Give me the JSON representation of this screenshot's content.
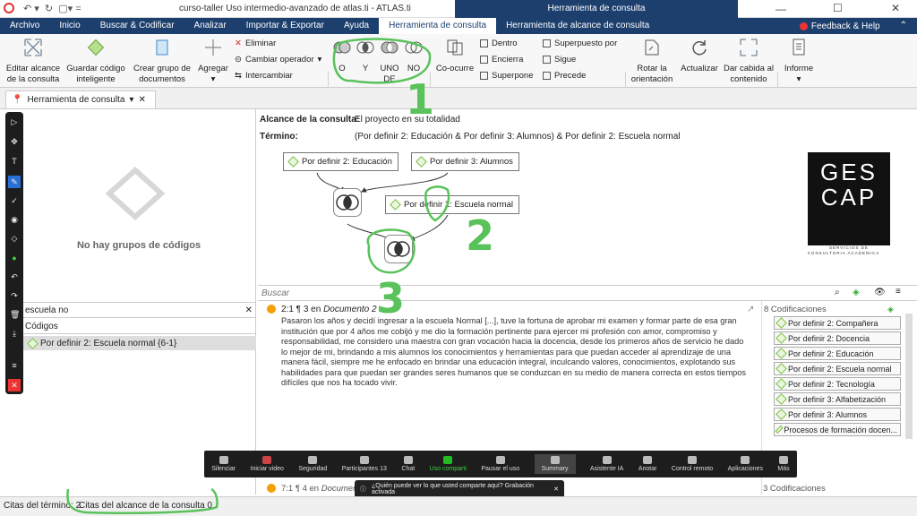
{
  "window": {
    "title": "curso-taller Uso intermedio-avanzado de atlas.ti - ATLAS.ti",
    "context_tab": "Herramienta de consulta"
  },
  "tabs": [
    "Archivo",
    "Inicio",
    "Buscar & Codificar",
    "Analizar",
    "Importar & Exportar",
    "Ayuda",
    "Herramienta de consulta",
    "Herramienta de alcance de consulta"
  ],
  "help": "Feedback & Help",
  "ribbon": {
    "edit_scope": "Editar alcance de la consulta",
    "save_smart": "Guardar código inteligente",
    "create_group": "Crear grupo de documentos",
    "add": "Agregar",
    "delete": "Eliminar",
    "change_op": "Cambiar operador",
    "swap": "Intercambiar",
    "ops": [
      "O",
      "Y",
      "UNO DE",
      "NO"
    ],
    "cooccur": "Co-ocurre",
    "prox": [
      "Dentro",
      "Encierra",
      "Superpone"
    ],
    "prox2": [
      "Superpuesto por",
      "Sigue",
      "Precede"
    ],
    "rotate": "Rotar la orientación",
    "update": "Actualizar",
    "fit": "Dar cabida al contenido",
    "report": "Informe"
  },
  "doc_tab": "Herramienta de consulta",
  "left": {
    "no_groups": "No hay grupos de códigos",
    "search_value": "escuela no",
    "codes_header": "Códigos",
    "code_item": "Por definir 2: Escuela normal {6-1}"
  },
  "query": {
    "scope_label": "Alcance de la consulta:",
    "scope_value": "El proyecto en su totalidad",
    "term_label": "Término:",
    "term_value": "(Por definir 2: Educación & Por definir 3: Alumnos) & Por definir 2: Escuela normal"
  },
  "nodes": [
    "Por definir 2: Educación",
    "Por definir 3: Alumnos",
    "Por definir 2: Escuela normal"
  ],
  "logo": {
    "text1": "GES",
    "text2": "CAP",
    "sub1": "SERVICIOS DE",
    "sub2": "CONSULTORIA ACADEMICA"
  },
  "search_placeholder": "Buscar",
  "quote": {
    "ref": "2:1 ¶ 3 en",
    "doc": "Documento 2",
    "text": "Pasaron los años y decidí ingresar a la escuela Normal [...], tuve la fortuna de aprobar mi examen y formar parte de esa gran institución que por 4 años me cobijó y me dio la formación pertinente para ejercer mi profesión con amor, compromiso y responsabilidad, me considero  una maestra con gran vocación hacia la docencia, desde los primeros años de servicio he dado lo mejor de mi, brindando a mis alumnos los conocimientos y herramientas para que puedan acceder al aprendizaje de una manera fácil, siempre me he enfocado en brindar una educación integral, inculcando valores, conocimientos, explotando sus habilidades para que puedan ser grandes seres humanos que se conduzcan en su medio de manera correcta en estos tiempos difíciles que nos ha tocado vivir.",
    "ref2": "7:1 ¶ 4 en",
    "doc2": "Documento"
  },
  "codings": {
    "header": "8 Codificaciones",
    "items": [
      "Por definir 2: Compañera",
      "Por definir 2: Docencia",
      "Por definir 2: Educación",
      "Por definir 2: Escuela normal",
      "Por definir 2: Tecnología",
      "Por definir 3: Alfabetización",
      "Por definir 3: Alumnos",
      "Procesos de formación docen..."
    ],
    "header2": "3 Codificaciones"
  },
  "zoom": [
    "Silenciar",
    "Iniciar video",
    "Seguridad",
    "Participantes",
    "Chat",
    "Uso comparti",
    "Pausar el uso",
    "Summary",
    "Asistente IA",
    "Anotar",
    "Control remoto",
    "Aplicaciones",
    "Más"
  ],
  "zoom_count": "13",
  "notice": "¿Quién puede ver lo que usted comparte aquí? Grabación activada",
  "status": {
    "left": "Citas del término: 2",
    "right": "Citas del alcance de la consulta 0"
  },
  "annot": [
    "1",
    "2",
    "3"
  ]
}
